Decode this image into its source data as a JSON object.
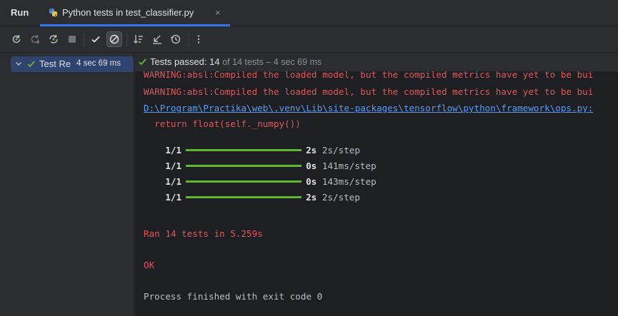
{
  "header": {
    "run_label": "Run",
    "tab_label": "Python tests in test_classifier.py",
    "tab_close": "×"
  },
  "colors": {
    "accent": "#3574f0",
    "success": "#5fb832",
    "error_text": "#e0575a",
    "link": "#589df6",
    "selection": "#2e436e"
  },
  "toolbar": {
    "icons": [
      "rerun-icon",
      "rerun-failed-icon",
      "toggle-auto-test-icon",
      "stop-icon",
      "show-passed-icon",
      "show-ignored-icon",
      "sort-icon",
      "import-tests-icon",
      "history-icon",
      "more-icon"
    ]
  },
  "tree": {
    "root_label": "Test Re",
    "root_time": "4 sec 69 ms"
  },
  "status": {
    "label": "Tests passed:",
    "passed": "14",
    "meta": "of 14 tests – 4 sec 69 ms"
  },
  "console": {
    "warning_cut": "WARNING:absl:Compiled the loaded model, but the compiled metrics have yet to be bui",
    "warning": "WARNING:absl:Compiled the loaded model, but the compiled metrics have yet to be bui",
    "link_path": "D:\\Program\\Practika\\web\\.venv\\Lib\\site-packages\\tensorflow\\python\\framework\\ops.py:",
    "return_line": "  return float(self._numpy())",
    "progress": [
      {
        "step": "1/1",
        "secs": "2s",
        "rate": "2s/step",
        "fraction": 1.0
      },
      {
        "step": "1/1",
        "secs": "0s",
        "rate": "141ms/step",
        "fraction": 1.0
      },
      {
        "step": "1/1",
        "secs": "0s",
        "rate": "143ms/step",
        "fraction": 1.0
      },
      {
        "step": "1/1",
        "secs": "2s",
        "rate": "2s/step",
        "fraction": 1.0
      }
    ],
    "ran": "Ran 14 tests in 5.259s",
    "ok": "OK",
    "exit": "Process finished with exit code 0"
  }
}
